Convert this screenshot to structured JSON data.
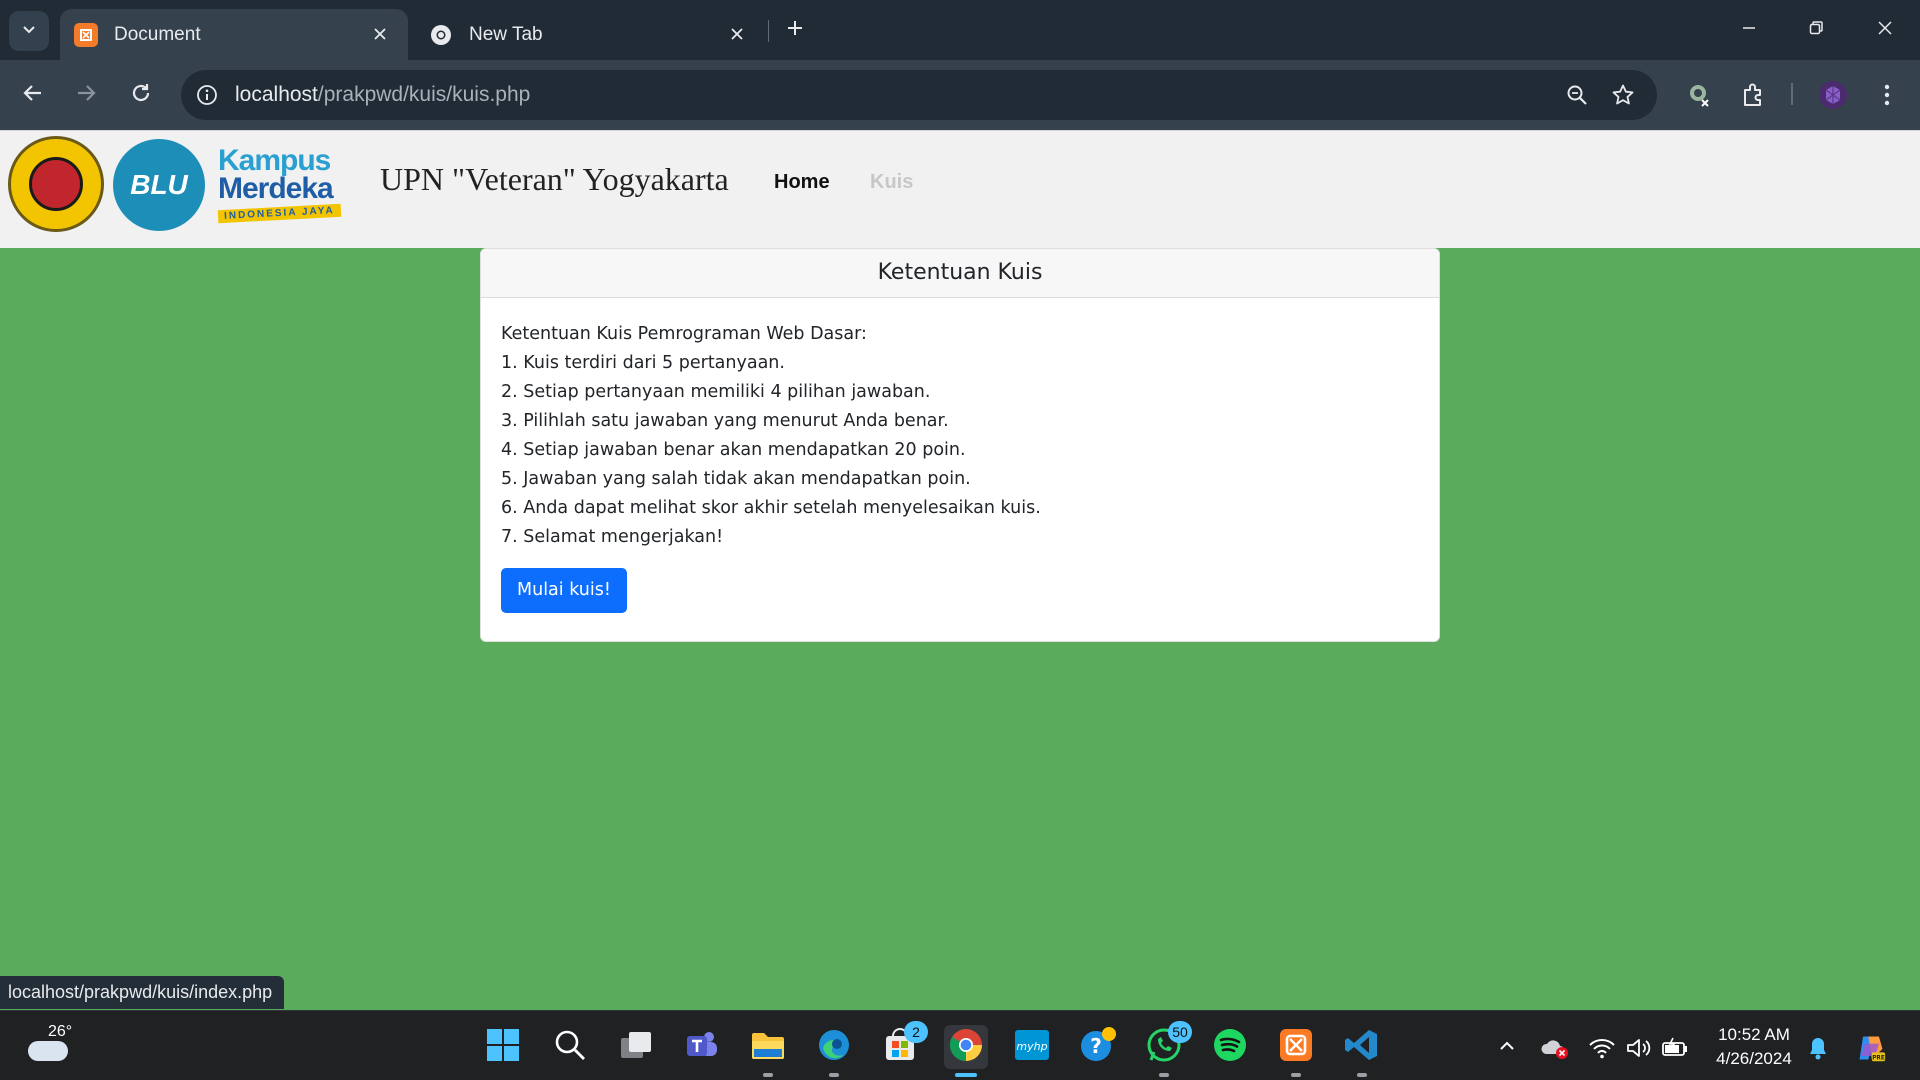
{
  "browser": {
    "tabs": [
      {
        "title": "Document",
        "active": true
      },
      {
        "title": "New Tab",
        "active": false
      }
    ],
    "url_host": "localhost",
    "url_path": "/prakpwd/kuis/kuis.php",
    "status_url": "localhost/prakpwd/kuis/index.php"
  },
  "navbar": {
    "logo_blu_text": "BLU",
    "logo_km_word1": "Kampus",
    "logo_km_word2": "Merdeka",
    "logo_km_tag": "INDONESIA JAYA",
    "brand": "UPN \"Veteran\" Yogyakarta",
    "links": [
      {
        "label": "Home",
        "active": true
      },
      {
        "label": "Kuis",
        "active": false
      }
    ]
  },
  "card": {
    "header": "Ketentuan Kuis",
    "lines": [
      "Ketentuan Kuis Pemrograman Web Dasar:",
      "1. Kuis terdiri dari 5 pertanyaan.",
      "2. Setiap pertanyaan memiliki 4 pilihan jawaban.",
      "3. Pilihlah satu jawaban yang menurut Anda benar.",
      "4. Setiap jawaban benar akan mendapatkan 20 poin.",
      "5. Jawaban yang salah tidak akan mendapatkan poin.",
      "6. Anda dapat melihat skor akhir setelah menyelesaikan kuis.",
      "7. Selamat mengerjakan!"
    ],
    "button_label": "Mulai kuis!"
  },
  "taskbar": {
    "weather_temp": "26°",
    "store_badge": "2",
    "whatsapp_badge": "50",
    "time": "10:52 AM",
    "date": "4/26/2024"
  },
  "colors": {
    "page_bg": "#5aac5c",
    "primary_button": "#0d6efd",
    "chrome_dark": "#202b36",
    "chrome_toolbar": "#35414d"
  }
}
